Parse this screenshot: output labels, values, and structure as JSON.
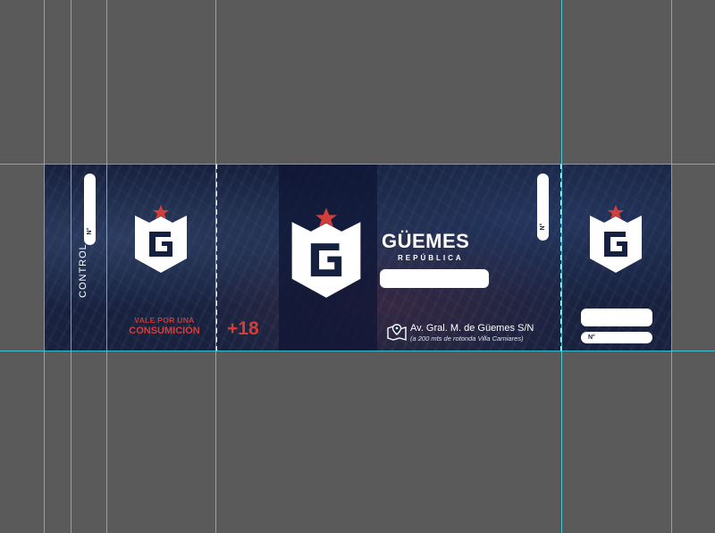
{
  "ticket": {
    "control_label": "CONTROL",
    "number_label": "N°",
    "vale_line1": "VALE POR UNA",
    "vale_line2": "CONSUMICIÓN",
    "age_restriction": "+18",
    "brand_name": "GÜEMES",
    "brand_sub": "REPÚBLICA",
    "address": "Av. Gral. M. de Güemes S/N",
    "address_note": "(a 200 mts de rotonda Villa Carniares)",
    "stub_number_label": "N°"
  },
  "icons": {
    "logo": "g-shield-star-logo",
    "pin": "map-pin-icon"
  },
  "colors": {
    "background": "#5a5a5a",
    "ticket": "#16213f",
    "accent": "#d23e3a",
    "guides": "#3fd6e6"
  }
}
